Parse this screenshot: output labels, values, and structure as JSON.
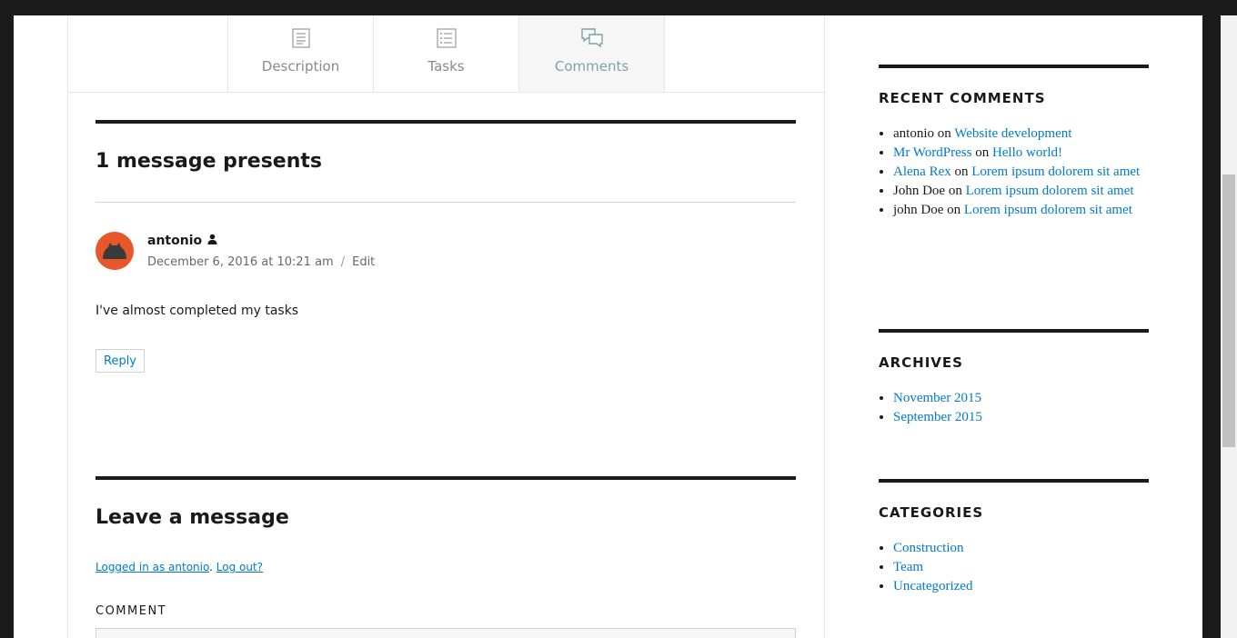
{
  "tabs": [
    {
      "label": "Description",
      "icon": "document-icon"
    },
    {
      "label": "Tasks",
      "icon": "list-icon"
    },
    {
      "label": "Comments",
      "icon": "comments-icon",
      "active": true
    }
  ],
  "comments_section": {
    "heading": "1 message presents",
    "comment": {
      "author": "antonio",
      "date": "December 6, 2016 at 10:21 am",
      "separator": "/",
      "edit_label": "Edit",
      "text": "I've almost completed my tasks",
      "reply_label": "Reply"
    }
  },
  "respond": {
    "heading": "Leave a message",
    "logged_in_link": "Logged in as antonio",
    "punct": ".",
    "logout_link": "Log out?",
    "comment_label": "COMMENT"
  },
  "sidebar": {
    "recent_comments": {
      "title": "RECENT COMMENTS",
      "items": [
        {
          "author": "antonio",
          "author_link": false,
          "on": "on",
          "post": "Website development"
        },
        {
          "author": "Mr WordPress",
          "author_link": true,
          "on": "on",
          "post": "Hello world!"
        },
        {
          "author": "Alena Rex",
          "author_link": true,
          "on": "on",
          "post": "Lorem ipsum dolorem sit amet"
        },
        {
          "author": "John Doe",
          "author_link": false,
          "on": "on",
          "post": "Lorem ipsum dolorem sit amet"
        },
        {
          "author": "john Doe",
          "author_link": false,
          "on": "on",
          "post": "Lorem ipsum dolorem sit amet"
        }
      ]
    },
    "archives": {
      "title": "ARCHIVES",
      "items": [
        "November 2015",
        "September 2015"
      ]
    },
    "categories": {
      "title": "CATEGORIES",
      "items": [
        "Construction",
        "Team",
        "Uncategorized"
      ]
    }
  },
  "colors": {
    "link": "#007acc",
    "active_tab": "#7aa4a6",
    "avatar_bg": "#e8572b"
  }
}
